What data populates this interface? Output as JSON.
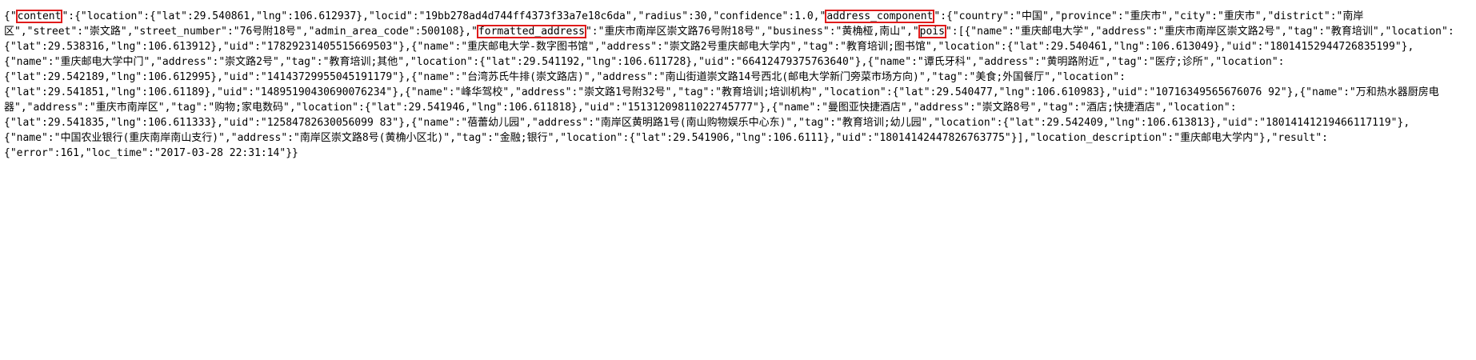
{
  "json_view": {
    "lines": [
      [
        "{\"",
        {
          "key": "content"
        },
        "\":{\"location\":{\"lat\":29.540861,\"lng\":106.612937},\"locid\":\"19bb278ad4d744ff4373f33a7e18c6da\",\"radius\":30,\"confidence\":1.0,\"",
        {
          "key": "address_component"
        },
        "\":{\"country\":\"中国\",\"province\":\"重庆市\",\"city\":\"重庆市\",\"district\":\"南岸"
      ],
      [
        "区\",\"street\":\"崇文路\",\"street_number\":\"76号附18号\",\"admin_area_code\":500108},\"",
        {
          "key": "formatted_address"
        },
        "\":\"重庆市南岸区崇文路76号附18号\",\"business\":\"黄桷桠,南山\",\"",
        {
          "key": "pois"
        },
        "\":[{\"name\":\"重庆邮电大学\",\"address\":\"重庆市南岸区崇文路2号\",\"tag\":\"教育培训\",\"location\":"
      ],
      [
        "{\"lat\":29.538316,\"lng\":106.613912},\"uid\":\"17829231405515669503\"},{\"name\":\"重庆邮电大学-数字图书馆\",\"address\":\"崇文路2号重庆邮电大学内\",\"tag\":\"教育培训;图书馆\",\"location\":{\"lat\":29.540461,\"lng\":106.613049},\"uid\":\"18014152944726835199\"},"
      ],
      [
        "{\"name\":\"重庆邮电大学中门\",\"address\":\"崇文路2号\",\"tag\":\"教育培训;其他\",\"location\":{\"lat\":29.541192,\"lng\":106.611728},\"uid\":\"66412479375763640\"},{\"name\":\"谭氏牙科\",\"address\":\"黄明路附近\",\"tag\":\"医疗;诊所\",\"location\":"
      ],
      [
        "{\"lat\":29.542189,\"lng\":106.612995},\"uid\":\"14143729955045191179\"},{\"name\":\"台湾苏氏牛排(崇文路店)\",\"address\":\"南山街道崇文路14号西北(邮电大学新门旁菜市场方向)\",\"tag\":\"美食;外国餐厅\",\"location\":"
      ],
      [
        "{\"lat\":29.541851,\"lng\":106.61189},\"uid\":\"14895190430690076234\"},{\"name\":\"峰华驾校\",\"address\":\"崇文路1号附32号\",\"tag\":\"教育培训;培训机构\",\"location\":{\"lat\":29.540477,\"lng\":106.610983},\"uid\":\"10716349565676076 92\"},{\"name\":\"万和热水器厨房电"
      ],
      [
        "器\",\"address\":\"重庆市南岸区\",\"tag\":\"购物;家电数码\",\"location\":{\"lat\":29.541946,\"lng\":106.611818},\"uid\":\"15131209811022745777\"},{\"name\":\"曼图亚快捷酒店\",\"address\":\"崇文路8号\",\"tag\":\"酒店;快捷酒店\",\"location\":"
      ],
      [
        "{\"lat\":29.541835,\"lng\":106.611333},\"uid\":\"12584782630056099 83\"},{\"name\":\"蓓蕾幼儿园\",\"address\":\"南岸区黄明路1号(南山购物娱乐中心东)\",\"tag\":\"教育培训;幼儿园\",\"location\":{\"lat\":29.542409,\"lng\":106.613813},\"uid\":\"18014141219466117119\"},"
      ],
      [
        "{\"name\":\"中国农业银行(重庆南岸南山支行)\",\"address\":\"南岸区崇文路8号(黄桷小区北)\",\"tag\":\"金融;银行\",\"location\":{\"lat\":29.541906,\"lng\":106.6111},\"uid\":\"18014142447826763775\"}],\"location_description\":\"重庆邮电大学内\"},\"result\":"
      ],
      [
        "{\"error\":161,\"loc_time\":\"2017-03-28 22:31:14\"}}"
      ]
    ]
  }
}
